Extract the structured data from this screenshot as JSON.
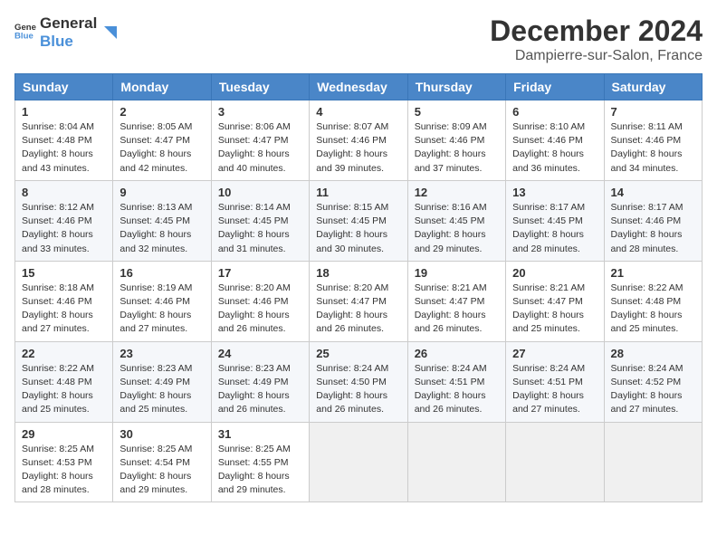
{
  "header": {
    "logo_general": "General",
    "logo_blue": "Blue",
    "month_year": "December 2024",
    "location": "Dampierre-sur-Salon, France"
  },
  "days_of_week": [
    "Sunday",
    "Monday",
    "Tuesday",
    "Wednesday",
    "Thursday",
    "Friday",
    "Saturday"
  ],
  "weeks": [
    [
      {
        "day": "1",
        "sunrise": "Sunrise: 8:04 AM",
        "sunset": "Sunset: 4:48 PM",
        "daylight": "Daylight: 8 hours and 43 minutes."
      },
      {
        "day": "2",
        "sunrise": "Sunrise: 8:05 AM",
        "sunset": "Sunset: 4:47 PM",
        "daylight": "Daylight: 8 hours and 42 minutes."
      },
      {
        "day": "3",
        "sunrise": "Sunrise: 8:06 AM",
        "sunset": "Sunset: 4:47 PM",
        "daylight": "Daylight: 8 hours and 40 minutes."
      },
      {
        "day": "4",
        "sunrise": "Sunrise: 8:07 AM",
        "sunset": "Sunset: 4:46 PM",
        "daylight": "Daylight: 8 hours and 39 minutes."
      },
      {
        "day": "5",
        "sunrise": "Sunrise: 8:09 AM",
        "sunset": "Sunset: 4:46 PM",
        "daylight": "Daylight: 8 hours and 37 minutes."
      },
      {
        "day": "6",
        "sunrise": "Sunrise: 8:10 AM",
        "sunset": "Sunset: 4:46 PM",
        "daylight": "Daylight: 8 hours and 36 minutes."
      },
      {
        "day": "7",
        "sunrise": "Sunrise: 8:11 AM",
        "sunset": "Sunset: 4:46 PM",
        "daylight": "Daylight: 8 hours and 34 minutes."
      }
    ],
    [
      {
        "day": "8",
        "sunrise": "Sunrise: 8:12 AM",
        "sunset": "Sunset: 4:46 PM",
        "daylight": "Daylight: 8 hours and 33 minutes."
      },
      {
        "day": "9",
        "sunrise": "Sunrise: 8:13 AM",
        "sunset": "Sunset: 4:45 PM",
        "daylight": "Daylight: 8 hours and 32 minutes."
      },
      {
        "day": "10",
        "sunrise": "Sunrise: 8:14 AM",
        "sunset": "Sunset: 4:45 PM",
        "daylight": "Daylight: 8 hours and 31 minutes."
      },
      {
        "day": "11",
        "sunrise": "Sunrise: 8:15 AM",
        "sunset": "Sunset: 4:45 PM",
        "daylight": "Daylight: 8 hours and 30 minutes."
      },
      {
        "day": "12",
        "sunrise": "Sunrise: 8:16 AM",
        "sunset": "Sunset: 4:45 PM",
        "daylight": "Daylight: 8 hours and 29 minutes."
      },
      {
        "day": "13",
        "sunrise": "Sunrise: 8:17 AM",
        "sunset": "Sunset: 4:45 PM",
        "daylight": "Daylight: 8 hours and 28 minutes."
      },
      {
        "day": "14",
        "sunrise": "Sunrise: 8:17 AM",
        "sunset": "Sunset: 4:46 PM",
        "daylight": "Daylight: 8 hours and 28 minutes."
      }
    ],
    [
      {
        "day": "15",
        "sunrise": "Sunrise: 8:18 AM",
        "sunset": "Sunset: 4:46 PM",
        "daylight": "Daylight: 8 hours and 27 minutes."
      },
      {
        "day": "16",
        "sunrise": "Sunrise: 8:19 AM",
        "sunset": "Sunset: 4:46 PM",
        "daylight": "Daylight: 8 hours and 27 minutes."
      },
      {
        "day": "17",
        "sunrise": "Sunrise: 8:20 AM",
        "sunset": "Sunset: 4:46 PM",
        "daylight": "Daylight: 8 hours and 26 minutes."
      },
      {
        "day": "18",
        "sunrise": "Sunrise: 8:20 AM",
        "sunset": "Sunset: 4:47 PM",
        "daylight": "Daylight: 8 hours and 26 minutes."
      },
      {
        "day": "19",
        "sunrise": "Sunrise: 8:21 AM",
        "sunset": "Sunset: 4:47 PM",
        "daylight": "Daylight: 8 hours and 26 minutes."
      },
      {
        "day": "20",
        "sunrise": "Sunrise: 8:21 AM",
        "sunset": "Sunset: 4:47 PM",
        "daylight": "Daylight: 8 hours and 25 minutes."
      },
      {
        "day": "21",
        "sunrise": "Sunrise: 8:22 AM",
        "sunset": "Sunset: 4:48 PM",
        "daylight": "Daylight: 8 hours and 25 minutes."
      }
    ],
    [
      {
        "day": "22",
        "sunrise": "Sunrise: 8:22 AM",
        "sunset": "Sunset: 4:48 PM",
        "daylight": "Daylight: 8 hours and 25 minutes."
      },
      {
        "day": "23",
        "sunrise": "Sunrise: 8:23 AM",
        "sunset": "Sunset: 4:49 PM",
        "daylight": "Daylight: 8 hours and 25 minutes."
      },
      {
        "day": "24",
        "sunrise": "Sunrise: 8:23 AM",
        "sunset": "Sunset: 4:49 PM",
        "daylight": "Daylight: 8 hours and 26 minutes."
      },
      {
        "day": "25",
        "sunrise": "Sunrise: 8:24 AM",
        "sunset": "Sunset: 4:50 PM",
        "daylight": "Daylight: 8 hours and 26 minutes."
      },
      {
        "day": "26",
        "sunrise": "Sunrise: 8:24 AM",
        "sunset": "Sunset: 4:51 PM",
        "daylight": "Daylight: 8 hours and 26 minutes."
      },
      {
        "day": "27",
        "sunrise": "Sunrise: 8:24 AM",
        "sunset": "Sunset: 4:51 PM",
        "daylight": "Daylight: 8 hours and 27 minutes."
      },
      {
        "day": "28",
        "sunrise": "Sunrise: 8:24 AM",
        "sunset": "Sunset: 4:52 PM",
        "daylight": "Daylight: 8 hours and 27 minutes."
      }
    ],
    [
      {
        "day": "29",
        "sunrise": "Sunrise: 8:25 AM",
        "sunset": "Sunset: 4:53 PM",
        "daylight": "Daylight: 8 hours and 28 minutes."
      },
      {
        "day": "30",
        "sunrise": "Sunrise: 8:25 AM",
        "sunset": "Sunset: 4:54 PM",
        "daylight": "Daylight: 8 hours and 29 minutes."
      },
      {
        "day": "31",
        "sunrise": "Sunrise: 8:25 AM",
        "sunset": "Sunset: 4:55 PM",
        "daylight": "Daylight: 8 hours and 29 minutes."
      },
      null,
      null,
      null,
      null
    ]
  ]
}
